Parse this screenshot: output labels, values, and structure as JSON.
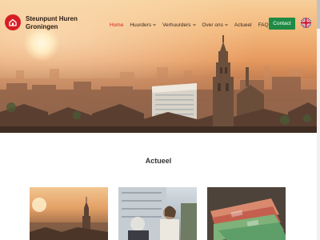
{
  "brand": {
    "name_line1": "Steunpunt Huren",
    "name_line2": "Groningen",
    "logo_icon": "house-icon",
    "color": "#d81e23"
  },
  "nav": {
    "items": [
      {
        "label": "Home",
        "active": true,
        "dropdown": false
      },
      {
        "label": "Huurders",
        "active": false,
        "dropdown": true
      },
      {
        "label": "Verhuurders",
        "active": false,
        "dropdown": true
      },
      {
        "label": "Over ons",
        "active": false,
        "dropdown": true
      },
      {
        "label": "Actueel",
        "active": false,
        "dropdown": false
      },
      {
        "label": "FAQ",
        "active": false,
        "dropdown": false
      }
    ],
    "contact_label": "Contact",
    "contact_color": "#1f8a44",
    "language_icon": "uk-flag-icon"
  },
  "hero": {
    "image": "groningen-skyline-sunset"
  },
  "actueel": {
    "title": "Actueel",
    "cards": [
      {
        "image": "groningen-city-sunset"
      },
      {
        "image": "elderly-women-apartment"
      },
      {
        "image": "euro-banknotes"
      }
    ]
  }
}
